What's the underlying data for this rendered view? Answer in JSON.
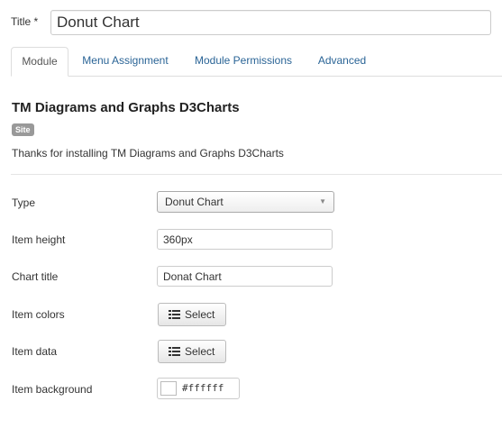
{
  "title_field": {
    "label": "Title *",
    "value": "Donut Chart"
  },
  "tabs": [
    {
      "label": "Module",
      "active": true
    },
    {
      "label": "Menu Assignment",
      "active": false
    },
    {
      "label": "Module Permissions",
      "active": false
    },
    {
      "label": "Advanced",
      "active": false
    }
  ],
  "module": {
    "heading": "TM Diagrams and Graphs D3Charts",
    "badge": "Site",
    "description": "Thanks for installing TM Diagrams and Graphs D3Charts"
  },
  "fields": {
    "type": {
      "label": "Type",
      "value": "Donut Chart"
    },
    "item_height": {
      "label": "Item height",
      "value": "360px"
    },
    "chart_title": {
      "label": "Chart title",
      "value": "Donat Chart"
    },
    "item_colors": {
      "label": "Item colors",
      "button": "Select"
    },
    "item_data": {
      "label": "Item data",
      "button": "Select"
    },
    "item_background": {
      "label": "Item background",
      "value": "#ffffff",
      "swatch_color": "#ffffff"
    }
  },
  "icons": {
    "list": "list-icon",
    "dropdown": "caret-down-icon"
  },
  "colors": {
    "link": "#2a6496",
    "badge": "#999999",
    "border": "#cccccc"
  }
}
